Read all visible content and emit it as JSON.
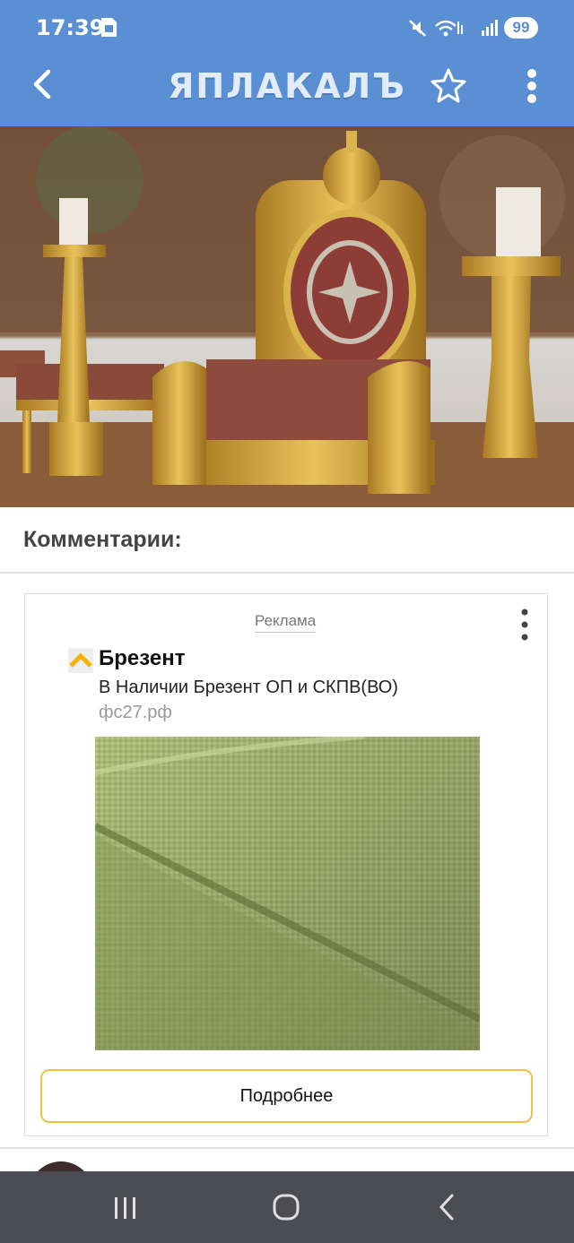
{
  "status_bar": {
    "time": "17:39",
    "battery": "99",
    "icons": [
      "sim-card-icon",
      "mute-icon",
      "wifi-icon",
      "signal-icon"
    ]
  },
  "app_bar": {
    "logo_text": "ЯПЛАКАЛЪ",
    "back_icon": "back-arrow-icon",
    "favorite_icon": "star-outline-icon",
    "menu_icon": "more-vert-icon"
  },
  "comments": {
    "title": "Комментарии:"
  },
  "ad": {
    "label": "Реклама",
    "title": "Брезент",
    "description": "В Наличии Брезент ОП и СКПВ(ВО)",
    "domain": "фс27.рф",
    "button_label": "Подробнее",
    "colors": {
      "button_border": "#f0c33c",
      "logo_yellow": "#f5b300"
    }
  },
  "nav_bar": {
    "items": [
      "recents-icon",
      "home-icon",
      "back-icon"
    ]
  },
  "colors": {
    "header": "#5b8fd4",
    "nav_bar": "#4c4d52"
  }
}
